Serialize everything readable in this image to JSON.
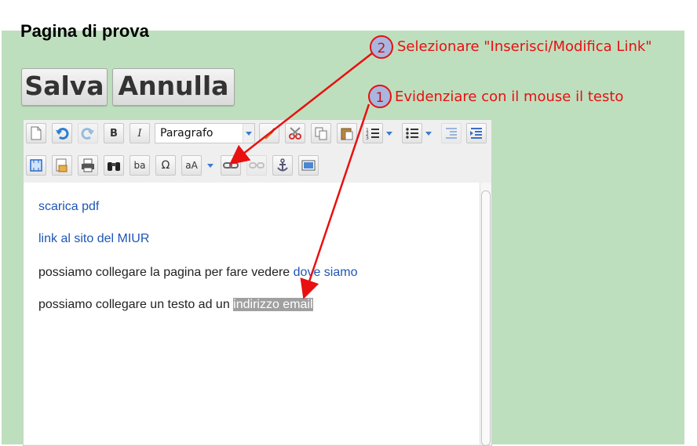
{
  "page": {
    "title": "Pagina di prova"
  },
  "buttons": {
    "save": "Salva",
    "cancel": "Annulla"
  },
  "toolbar": {
    "format_value": "Paragrafo",
    "row1": [
      "new-page-icon",
      "undo-icon",
      "redo-icon",
      "bold-icon",
      "italic-icon",
      "format-select",
      "paint-brush-icon",
      "cut-icon",
      "copy-icon",
      "paste-icon",
      "numbered-list-icon",
      "bulleted-list-icon",
      "outdent-icon",
      "indent-icon"
    ],
    "row2": [
      "maximize-icon",
      "templates-icon",
      "print-icon",
      "find-icon",
      "replace-icon",
      "special-char-icon",
      "text-color-icon",
      "link-icon",
      "unlink-icon",
      "anchor-icon",
      "image-icon"
    ],
    "bold_glyph": "B",
    "italic_glyph": "I",
    "omega_glyph": "Ω",
    "replace_glyph": "ba",
    "color_glyph": "aA"
  },
  "content": {
    "p1_link": "scarica pdf",
    "p2_link": "link al sito del MIUR",
    "p3_text": "possiamo collegare la pagina per fare vedere ",
    "p3_link": "dove siamo",
    "p4_text": "possiamo collegare un testo ad un ",
    "p4_selected": "indirizzo email"
  },
  "annotations": [
    {
      "number": "2",
      "text": "Selezionare \"Inserisci/Modifica Link\""
    },
    {
      "number": "1",
      "text": "Evidenziare con il mouse il testo"
    }
  ],
  "colors": {
    "background": "#bedfbe",
    "annotation": "#e81010",
    "link": "#1e56b4",
    "selection": "#a0a0a0"
  }
}
